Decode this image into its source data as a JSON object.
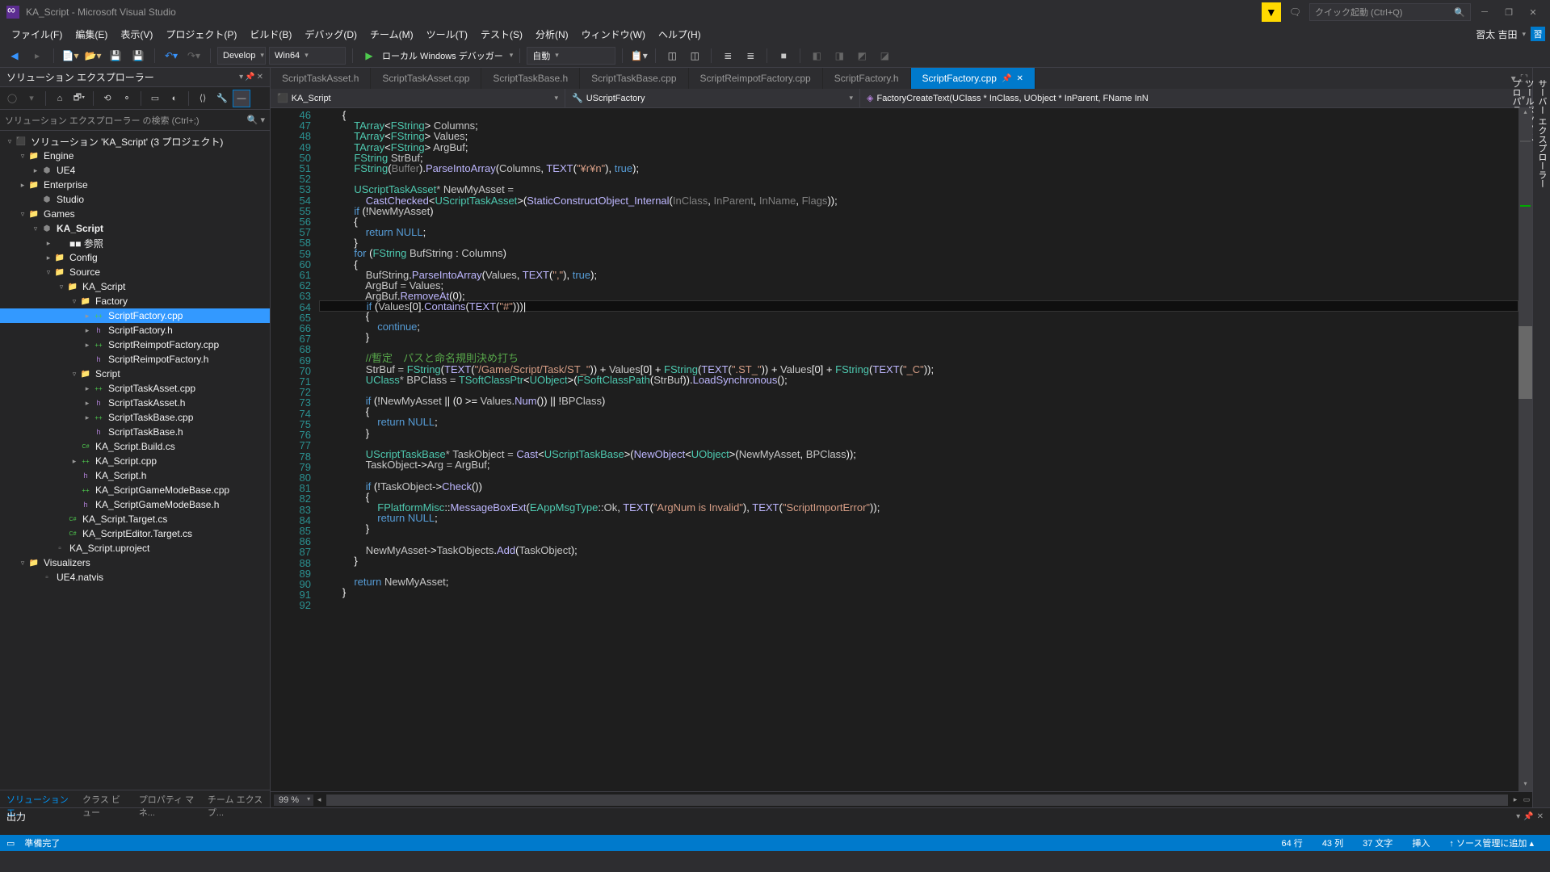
{
  "title": "KA_Script - Microsoft Visual Studio",
  "quick_launch": "クイック起動 (Ctrl+Q)",
  "menu": [
    "ファイル(F)",
    "編集(E)",
    "表示(V)",
    "プロジェクト(P)",
    "ビルド(B)",
    "デバッグ(D)",
    "チーム(M)",
    "ツール(T)",
    "テスト(S)",
    "分析(N)",
    "ウィンドウ(W)",
    "ヘルプ(H)"
  ],
  "user_name": "習太 吉田",
  "user_initial": "習",
  "toolbar": {
    "config": "Develop",
    "platform": "Win64",
    "debugger": "ローカル Windows デバッガー",
    "auto": "自動"
  },
  "sidebar": {
    "title": "ソリューション エクスプローラー",
    "search": "ソリューション エクスプローラー の検索 (Ctrl+;)",
    "tabs": [
      "ソリューション エ...",
      "クラス ビュー",
      "プロパティ マネ...",
      "チーム エクスプ..."
    ]
  },
  "tree": [
    {
      "d": 0,
      "chev": "▿",
      "icon": "sln",
      "label": "ソリューション 'KA_Script' (3 プロジェクト)"
    },
    {
      "d": 1,
      "chev": "▿",
      "icon": "folder",
      "label": "Engine"
    },
    {
      "d": 2,
      "chev": "▸",
      "icon": "proj",
      "label": "UE4"
    },
    {
      "d": 1,
      "chev": "▸",
      "icon": "folder",
      "label": "Enterprise"
    },
    {
      "d": 2,
      "chev": "",
      "icon": "proj",
      "label": "Studio"
    },
    {
      "d": 1,
      "chev": "▿",
      "icon": "folder",
      "label": "Games"
    },
    {
      "d": 2,
      "chev": "▿",
      "icon": "proj",
      "label": "KA_Script",
      "bold": true
    },
    {
      "d": 3,
      "chev": "▸",
      "icon": "ref",
      "label": "■■ 参照"
    },
    {
      "d": 3,
      "chev": "▸",
      "icon": "folder",
      "label": "Config"
    },
    {
      "d": 3,
      "chev": "▿",
      "icon": "folder",
      "label": "Source"
    },
    {
      "d": 4,
      "chev": "▿",
      "icon": "folder",
      "label": "KA_Script"
    },
    {
      "d": 5,
      "chev": "▿",
      "icon": "folder",
      "label": "Factory"
    },
    {
      "d": 6,
      "chev": "▸",
      "icon": "cpp",
      "label": "ScriptFactory.cpp",
      "sel": true
    },
    {
      "d": 6,
      "chev": "▸",
      "icon": "h",
      "label": "ScriptFactory.h"
    },
    {
      "d": 6,
      "chev": "▸",
      "icon": "cpp",
      "label": "ScriptReimpotFactory.cpp"
    },
    {
      "d": 6,
      "chev": "",
      "icon": "h",
      "label": "ScriptReimpotFactory.h"
    },
    {
      "d": 5,
      "chev": "▿",
      "icon": "folder",
      "label": "Script"
    },
    {
      "d": 6,
      "chev": "▸",
      "icon": "cpp",
      "label": "ScriptTaskAsset.cpp"
    },
    {
      "d": 6,
      "chev": "▸",
      "icon": "h",
      "label": "ScriptTaskAsset.h"
    },
    {
      "d": 6,
      "chev": "▸",
      "icon": "cpp",
      "label": "ScriptTaskBase.cpp"
    },
    {
      "d": 6,
      "chev": "",
      "icon": "h",
      "label": "ScriptTaskBase.h"
    },
    {
      "d": 5,
      "chev": "",
      "icon": "cs",
      "label": "KA_Script.Build.cs"
    },
    {
      "d": 5,
      "chev": "▸",
      "icon": "cpp",
      "label": "KA_Script.cpp"
    },
    {
      "d": 5,
      "chev": "",
      "icon": "h",
      "label": "KA_Script.h"
    },
    {
      "d": 5,
      "chev": "",
      "icon": "cpp",
      "label": "KA_ScriptGameModeBase.cpp"
    },
    {
      "d": 5,
      "chev": "",
      "icon": "h",
      "label": "KA_ScriptGameModeBase.h"
    },
    {
      "d": 4,
      "chev": "",
      "icon": "cs",
      "label": "KA_Script.Target.cs"
    },
    {
      "d": 4,
      "chev": "",
      "icon": "cs",
      "label": "KA_ScriptEditor.Target.cs"
    },
    {
      "d": 3,
      "chev": "",
      "icon": "file",
      "label": "KA_Script.uproject"
    },
    {
      "d": 1,
      "chev": "▿",
      "icon": "folder",
      "label": "Visualizers"
    },
    {
      "d": 2,
      "chev": "",
      "icon": "file",
      "label": "UE4.natvis"
    }
  ],
  "file_tabs": [
    "ScriptTaskAsset.h",
    "ScriptTaskAsset.cpp",
    "ScriptTaskBase.h",
    "ScriptTaskBase.cpp",
    "ScriptReimpotFactory.cpp",
    "ScriptFactory.h",
    "ScriptFactory.cpp"
  ],
  "active_tab": 6,
  "nav": {
    "project": "KA_Script",
    "class": "UScriptFactory",
    "method": "FactoryCreateText(UClass * InClass, UObject * InParent, FName InN"
  },
  "code_start": 46,
  "zoom": "99 %",
  "output": {
    "title": "出力"
  },
  "status": {
    "ready": "準備完了",
    "line": "64 行",
    "col": "43 列",
    "chars": "37 文字",
    "ins": "挿入",
    "src": "↑ ソース管理に追加 ▴"
  },
  "vert_tabs": [
    "サーバー エクスプローラー",
    "ツールボックス",
    "プロパティ"
  ]
}
